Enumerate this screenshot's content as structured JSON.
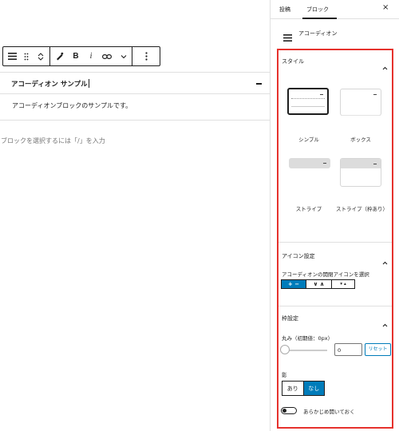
{
  "editor": {
    "toolbar": {
      "bold_label": "B",
      "italic_label": "i"
    },
    "accordion": {
      "title": "アコーディオン サンプル",
      "body": "アコーディオンブロックのサンプルです。"
    },
    "appender_placeholder": "ブロックを選択するには「/」を入力"
  },
  "sidebar": {
    "tabs": [
      {
        "label": "投稿",
        "active": false
      },
      {
        "label": "ブロック",
        "active": true
      }
    ],
    "close_label": "×",
    "block_name": "アコーディオン",
    "style_panel": {
      "title": "スタイル",
      "options": [
        {
          "label": "シンプル",
          "selected": true
        },
        {
          "label": "ボックス",
          "selected": false
        },
        {
          "label": "ストライプ",
          "selected": false
        },
        {
          "label": "ストライプ（枠あり）",
          "selected": false
        }
      ]
    },
    "icon_panel": {
      "title": "アイコン設定",
      "field_label": "アコーディオンの開閉アイコンを選択",
      "options": [
        {
          "label": "+ −",
          "selected": true
        },
        {
          "label": "∨ ∧",
          "selected": false
        },
        {
          "label": "▾ ▴",
          "selected": false
        }
      ]
    },
    "border_panel": {
      "title": "枠設定",
      "radius_label": "丸み（初期値：0px）",
      "radius_value": "0",
      "radius_slider_fraction": 0,
      "reset_label": "リセット",
      "shadow_label": "影",
      "shadow_options": [
        {
          "label": "あり",
          "selected": false
        },
        {
          "label": "なし",
          "selected": true
        }
      ],
      "toggle_label": "あらかじめ開いておく",
      "toggle_on": false
    }
  },
  "colors": {
    "accent": "#007cba",
    "highlight_frame": "#e6322d",
    "text": "#1e1e1e",
    "muted": "#757575"
  }
}
